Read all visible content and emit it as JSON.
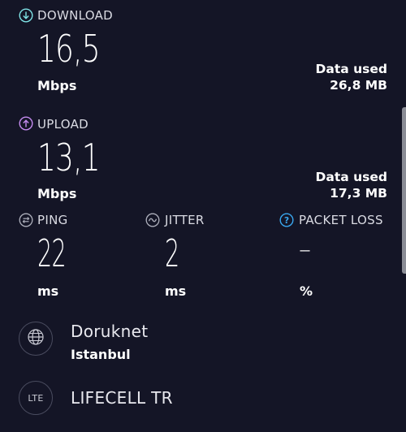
{
  "download": {
    "label": "DOWNLOAD",
    "value": "16,5",
    "unit": "Mbps",
    "data_used_label": "Data used",
    "data_used_value": "26,8 MB",
    "icon": "arrow-down-circle-icon",
    "icon_color": "#7fe3e6"
  },
  "upload": {
    "label": "UPLOAD",
    "value": "13,1",
    "unit": "Mbps",
    "data_used_label": "Data used",
    "data_used_value": "17,3 MB",
    "icon": "arrow-up-circle-icon",
    "icon_color": "#c58cf0"
  },
  "ping": {
    "label": "PING",
    "value": "22",
    "unit": "ms",
    "icon": "ping-icon"
  },
  "jitter": {
    "label": "JITTER",
    "value": "2",
    "unit": "ms",
    "icon": "wave-icon"
  },
  "packet_loss": {
    "label": "PACKET LOSS",
    "value": "–",
    "unit": "%",
    "icon": "question-circle-icon",
    "icon_color": "#3aa8f0"
  },
  "server": {
    "name": "Doruknet",
    "city": "Istanbul",
    "icon": "globe-icon"
  },
  "provider": {
    "name": "LIFECELL TR",
    "badge": "LTE"
  }
}
